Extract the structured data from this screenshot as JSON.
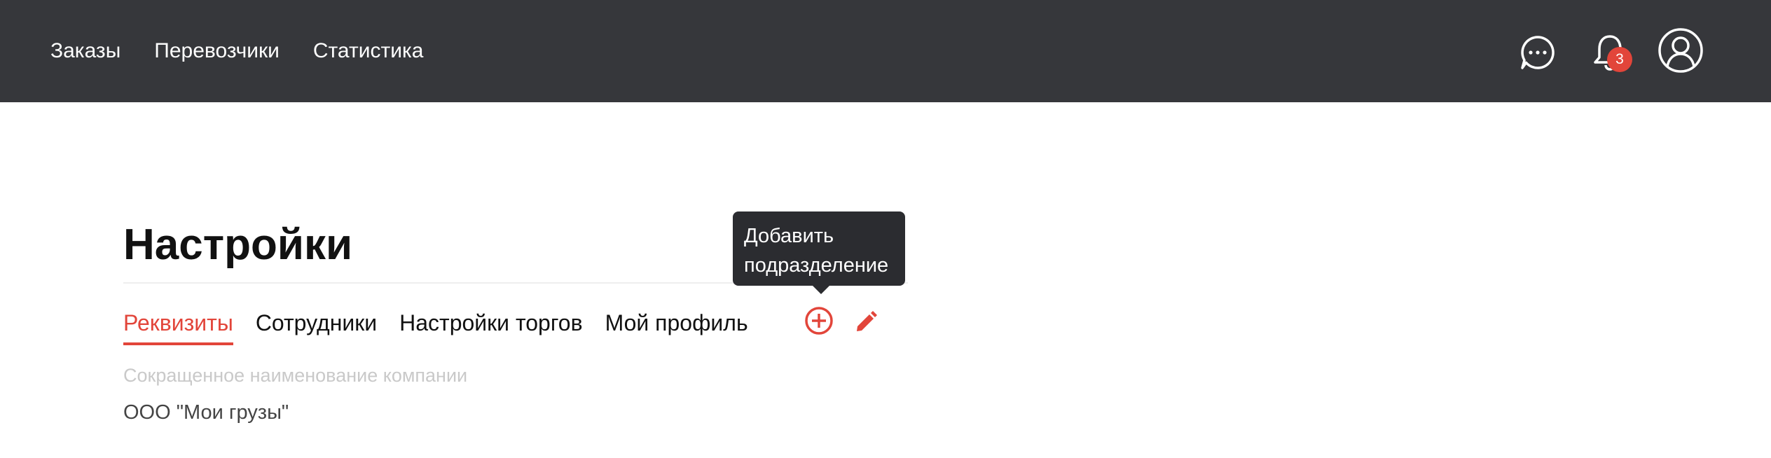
{
  "topbar": {
    "nav": [
      "Заказы",
      "Перевозчики",
      "Статистика"
    ],
    "notifications_count": "3",
    "icons": [
      "chat-dots-icon",
      "bell-icon",
      "user-icon"
    ],
    "background": "#36373b"
  },
  "page": {
    "title": "Настройки",
    "tabs": [
      "Реквизиты",
      "Сотрудники",
      "Настройки торгов",
      "Мой профиль"
    ],
    "active_tab": "Реквизиты",
    "actions": [
      "add-icon",
      "edit-icon"
    ],
    "tooltip": {
      "line1": "Добавить",
      "line2": "подразделение"
    },
    "field": {
      "label": "Сокращенное наименование компании",
      "value": "ООО \"Мои грузы\""
    },
    "accent_color": "#e2453a"
  }
}
